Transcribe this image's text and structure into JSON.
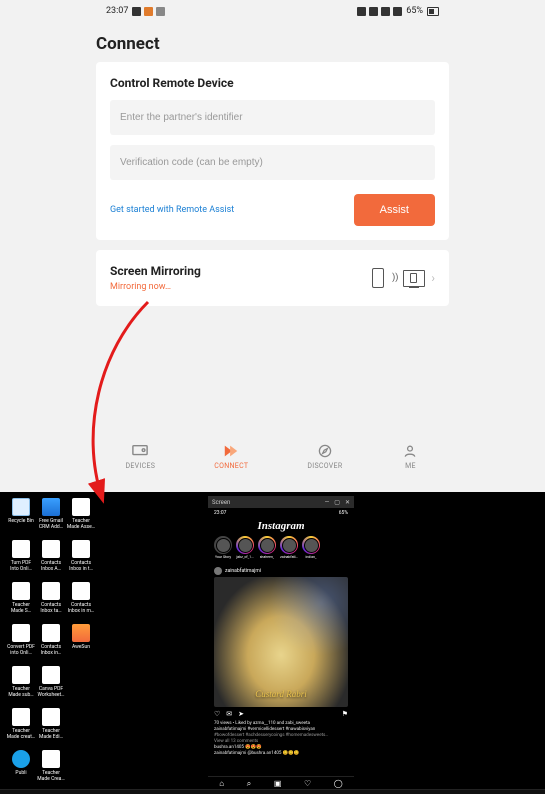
{
  "status_bar": {
    "time": "23:07",
    "left_icons": [
      "youtube-icon",
      "app-icon",
      "misc-icon"
    ],
    "right": "65%"
  },
  "app": {
    "page_title": "Connect",
    "control_card": {
      "title": "Control Remote Device",
      "identifier_placeholder": "Enter the partner's identifier",
      "code_placeholder": "Verification code (can be empty)",
      "link": "Get started with Remote Assist",
      "assist": "Assist"
    },
    "mirror_card": {
      "title": "Screen Mirroring",
      "status": "Mirroring now…"
    },
    "nav": {
      "devices": "DEVICES",
      "connect": "CONNECT",
      "discover": "DISCOVER",
      "me": "ME"
    }
  },
  "desktop": {
    "icons": [
      {
        "label": "Recycle Bin",
        "style": "bin"
      },
      {
        "label": "Free Gmail CRM Add…",
        "style": "blue"
      },
      {
        "label": "Teacher Made Asse…",
        "style": "white"
      },
      {
        "label": "Turn PDF Into Onli…",
        "style": "white"
      },
      {
        "label": "Contacts Inbox A…",
        "style": "white"
      },
      {
        "label": "Contacts Inbox in t…",
        "style": "white"
      },
      {
        "label": "Teacher Made S…",
        "style": "white"
      },
      {
        "label": "Contacts Inbox ta…",
        "style": "white"
      },
      {
        "label": "Contacts Inbox in m…",
        "style": "white"
      },
      {
        "label": "Convert PDF into Onli…",
        "style": "white"
      },
      {
        "label": "Contacts Inbox in…",
        "style": "white"
      },
      {
        "label": "AweSun",
        "style": "orange"
      },
      {
        "label": "Teacher Made sub…",
        "style": "white"
      },
      {
        "label": "Canva PDF Worksheet…",
        "style": "white"
      },
      {
        "label": "",
        "style": "none"
      },
      {
        "label": "Teacher Made creat…",
        "style": "white"
      },
      {
        "label": "Teacher Made Edi…",
        "style": "white"
      },
      {
        "label": "",
        "style": "none"
      },
      {
        "label": "Publi",
        "style": "circle"
      },
      {
        "label": "Teacher Made Crea…",
        "style": "white"
      },
      {
        "label": "",
        "style": "none"
      }
    ],
    "mirror_window": {
      "title": "Screen",
      "status_time": "23:07",
      "status_right": "65%",
      "app_name": "Instagram",
      "stories": [
        {
          "label": "Your Story",
          "ring": "plain"
        },
        {
          "label": "jabz_of_1…",
          "ring": "gradient"
        },
        {
          "label": "shaheen_",
          "ring": "gradient"
        },
        {
          "label": "zainabfati…",
          "ring": "gradient"
        },
        {
          "label": "indian_",
          "ring": "gradient"
        }
      ],
      "post": {
        "user": "zainabfatimajmi",
        "overlay": "Custard Rabri",
        "likes_line": "70 views • Liked by azma__110 and zabi_sweeta",
        "caption_line1": "zainabfatimajmi #vermicellidessert #nawabisviyan",
        "caption_line2": "#bowofdessert #achdesserycoings #homemadesweets…",
        "view_comments": "View all 13 comments",
        "comment1": "bushra.an1405 😍😍😍",
        "comment2": "zainabfatimajmi @bushra.an1405 😊😊😊"
      }
    }
  }
}
